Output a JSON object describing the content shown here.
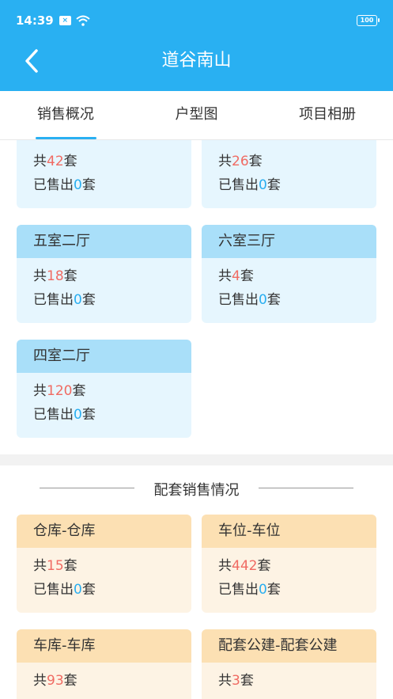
{
  "status": {
    "time": "14:39",
    "battery": "100"
  },
  "header": {
    "title": "道谷南山"
  },
  "tabs": [
    {
      "label": "销售概况",
      "active": true
    },
    {
      "label": "户型图",
      "active": false
    },
    {
      "label": "项目相册",
      "active": false
    }
  ],
  "labels": {
    "total_prefix": "共",
    "unit": "套",
    "sold_prefix": "已售出"
  },
  "housing": [
    {
      "name": "",
      "total": "42",
      "sold": "0"
    },
    {
      "name": "",
      "total": "26",
      "sold": "0"
    },
    {
      "name": "五室二厅",
      "total": "18",
      "sold": "0"
    },
    {
      "name": "六室三厅",
      "total": "4",
      "sold": "0"
    },
    {
      "name": "四室二厅",
      "total": "120",
      "sold": "0"
    }
  ],
  "section": {
    "title": "配套销售情况"
  },
  "ancillary": [
    {
      "name": "仓库-仓库",
      "total": "15",
      "sold": "0"
    },
    {
      "name": "车位-车位",
      "total": "442",
      "sold": "0"
    },
    {
      "name": "车库-车库",
      "total": "93"
    },
    {
      "name": "配套公建-配套公建",
      "total": "3"
    }
  ],
  "colors": {
    "primary": "#29b0f2",
    "total_number": "#f06b63",
    "sold_number": "#29aef0",
    "blue_header": "#a9dff9",
    "orange_header": "#fce0b3"
  }
}
